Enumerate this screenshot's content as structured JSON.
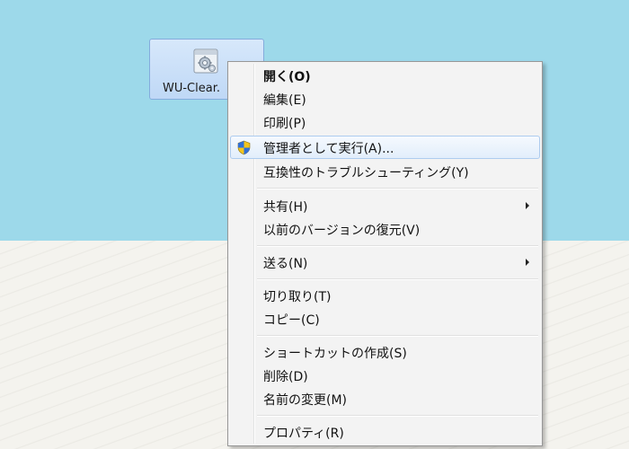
{
  "desktop": {
    "icon": {
      "label": "WU-Clear.",
      "icon_name": "gear-document-icon"
    }
  },
  "context_menu": {
    "items": [
      {
        "label": "開く(O)",
        "bold": true
      },
      {
        "label": "編集(E)"
      },
      {
        "label": "印刷(P)"
      },
      {
        "label": "管理者として実行(A)...",
        "icon": "uac-shield-icon",
        "highlighted": true
      },
      {
        "label": "互換性のトラブルシューティング(Y)"
      },
      {
        "label": "共有(H)",
        "submenu": true
      },
      {
        "label": "以前のバージョンの復元(V)"
      },
      {
        "label": "送る(N)",
        "submenu": true
      },
      {
        "label": "切り取り(T)"
      },
      {
        "label": "コピー(C)"
      },
      {
        "label": "ショートカットの作成(S)"
      },
      {
        "label": "削除(D)"
      },
      {
        "label": "名前の変更(M)"
      },
      {
        "label": "プロパティ(R)"
      }
    ]
  },
  "colors": {
    "desktop_background": "#9dd9ea",
    "menu_background": "#f3f3f3",
    "highlight_border": "#aeccef"
  }
}
